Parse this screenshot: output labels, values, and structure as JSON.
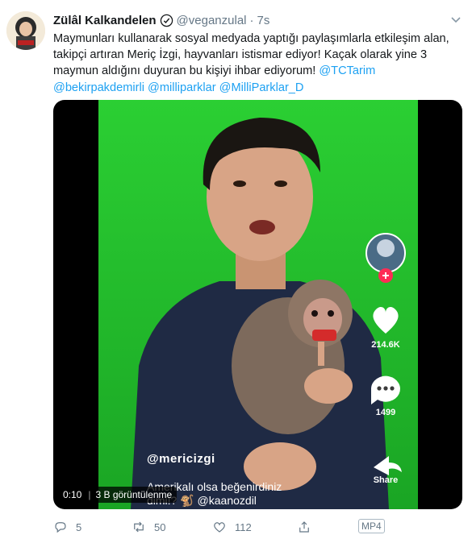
{
  "tweet": {
    "author_name": "Zülâl Kalkandelen",
    "handle": "@veganzulal",
    "separator": "·",
    "time": "7s",
    "text_lines": [
      "Maymunları kullanarak sosyal medyada yaptığı paylaşımlarla etkileşim alan,",
      "takipçi artıran Meriç İzgi, hayvanları istismar ediyor! Kaçak olarak yine 3",
      "maymun aldığını duyuran bu kişiyi ihbar ediyorum!"
    ],
    "mentions": {
      "m1": "@TCTarim",
      "m2": "@bekirpakdemirli",
      "m3": "@milliparklar",
      "m4": "@MilliParklar_D"
    }
  },
  "video": {
    "tiktok": {
      "likes": "214.6K",
      "comments": "1499",
      "share_label": "Share"
    },
    "overlay_handle": "@mericizgi",
    "overlay_caption_line1": "Amerikalı olsa beğenirdiniz",
    "overlay_caption_line2": "dimi!? 🐒 @kaanozdil",
    "elapsed": "0:10",
    "views": "3 B görüntülenme"
  },
  "actions": {
    "replies": "5",
    "retweets": "50",
    "likes": "112",
    "media_badge": "MP4"
  },
  "colors": {
    "link": "#1da1f2",
    "muted": "#657786",
    "green_screen": "#21c12a"
  }
}
